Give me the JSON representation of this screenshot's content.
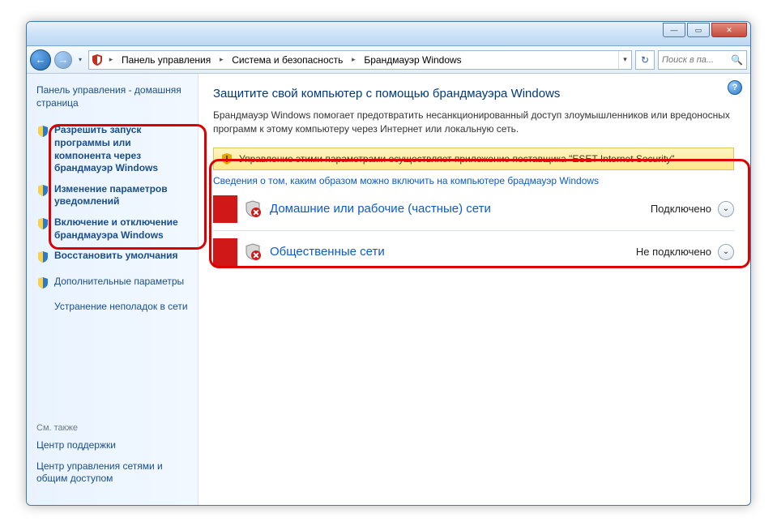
{
  "titlebar": {
    "min": "—",
    "max": "▭",
    "close": "✕"
  },
  "addressbar": {
    "back": "←",
    "fwd": "→",
    "dd": "▾",
    "crumbs": [
      "Панель управления",
      "Система и безопасность",
      "Брандмауэр Windows"
    ],
    "crumb_dd": "▾",
    "refresh": "↻",
    "search_placeholder": "Поиск в па...",
    "search_icon": "🔍"
  },
  "sidebar": {
    "home": "Панель управления - домашняя страница",
    "links": [
      {
        "label": "Разрешить запуск программы или компонента через брандмауэр Windows",
        "shield": true,
        "hi": true
      },
      {
        "label": "Изменение параметров уведомлений",
        "shield": true,
        "hi": true
      },
      {
        "label": "Включение и отключение брандмауэра Windows",
        "shield": true,
        "hi": true
      },
      {
        "label": "Восстановить умолчания",
        "shield": true,
        "hi": true
      },
      {
        "label": "Дополнительные параметры",
        "shield": true,
        "hi": false
      },
      {
        "label": "Устранение неполадок в сети",
        "shield": false,
        "hi": false
      }
    ],
    "see_also_header": "См. также",
    "see_also": [
      "Центр поддержки",
      "Центр управления сетями и общим доступом"
    ]
  },
  "main": {
    "help": "?",
    "title": "Защитите свой компьютер с помощью брандмауэра Windows",
    "desc": "Брандмауэр Windows помогает предотвратить несанкционированный доступ злоумышленников или вредоносных программ к этому компьютеру через Интернет или локальную сеть.",
    "warn": "Управление этими параметрами осуществляет приложение поставщика \"ESET Internet Security\"",
    "info_link": "Сведения о том, каким образом можно включить на компьютере брадмауэр Windows",
    "networks": [
      {
        "title": "Домашние или рабочие (частные) сети",
        "status": "Подключено",
        "expand": "⌄"
      },
      {
        "title": "Общественные сети",
        "status": "Не подключено",
        "expand": "⌄"
      }
    ]
  }
}
